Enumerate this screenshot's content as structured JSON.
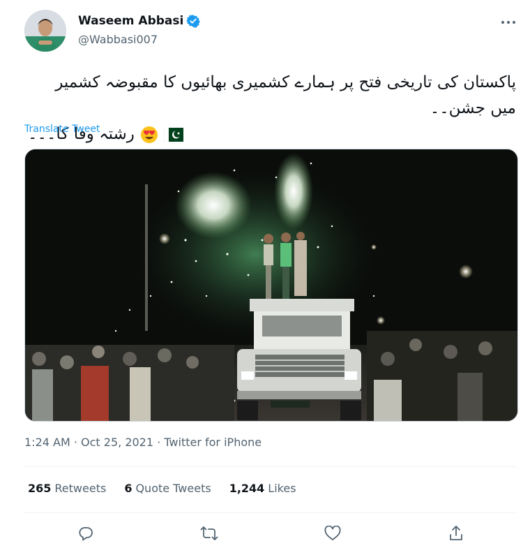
{
  "author": {
    "display_name": "Waseem Abbasi",
    "handle": "@Wabbasi007"
  },
  "tweet": {
    "text_line1": "پاکستان کی تاریخی فتح پر ہمارے کشمیری بھائیوں کا مقبوضہ کشمیر میں جشن۔۔",
    "text_line2": "رشتہ وفا کا۔۔۔"
  },
  "translate_label": "Translate Tweet",
  "meta": {
    "time": "1:24 AM",
    "date": "Oct 25, 2021",
    "source": "Twitter for iPhone",
    "separator": " · "
  },
  "stats": [
    {
      "count": "265",
      "label": "Retweets"
    },
    {
      "count": "6",
      "label": "Quote Tweets"
    },
    {
      "count": "1,244",
      "label": "Likes"
    }
  ],
  "icons": {
    "verified": "verified-badge-icon",
    "more": "more-dots-icon",
    "reply": "reply-icon",
    "retweet": "retweet-icon",
    "like": "like-heart-icon",
    "share": "share-icon",
    "emoji": "heart-eyes-emoji-icon",
    "flag": "pakistan-flag-icon"
  },
  "colors": {
    "link": "#1d9bf0",
    "secondary_text": "#536471",
    "primary_text": "#0f1419",
    "verified": "#1d9bf0"
  }
}
